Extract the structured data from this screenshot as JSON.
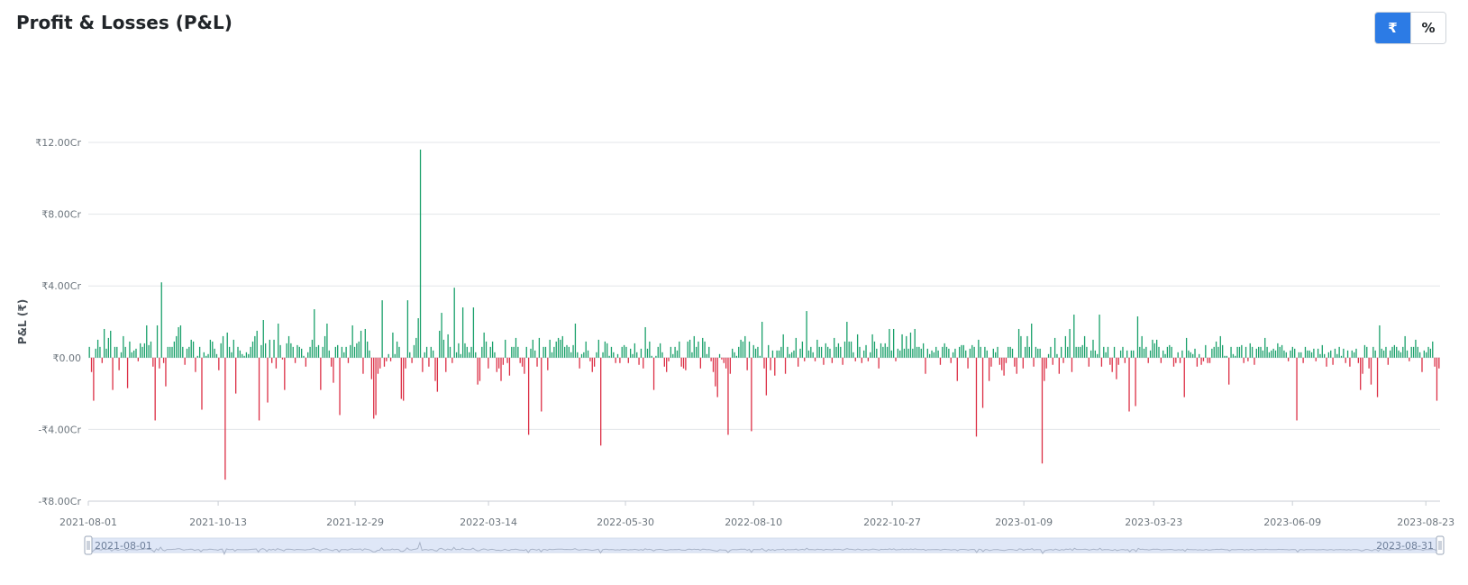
{
  "header": {
    "title": "Profit & Losses (P&L)",
    "toggle": {
      "rupee_label": "₹",
      "percent_label": "%",
      "selected": "rupee"
    }
  },
  "colors": {
    "profit": "#19a06a",
    "loss": "#dc2f45",
    "grid": "#e3e6ea",
    "toggle_active": "#2c7be5",
    "zoom_fill": "#dfe7f7"
  },
  "chart_data": {
    "type": "bar",
    "title": "",
    "xlabel": "",
    "ylabel": "P&L (₹)",
    "y_unit": "Cr",
    "ylim": [
      -8,
      12
    ],
    "y_ticks": [
      {
        "value": 12,
        "label": "₹12.00Cr"
      },
      {
        "value": 8,
        "label": "₹8.00Cr"
      },
      {
        "value": 4,
        "label": "₹4.00Cr"
      },
      {
        "value": 0,
        "label": "₹0.00"
      },
      {
        "value": -4,
        "label": "-₹4.00Cr"
      },
      {
        "value": -8,
        "label": "-₹8.00Cr"
      }
    ],
    "x_range": [
      "2021-08-01",
      "2023-08-31"
    ],
    "x_ticks": [
      "2021-08-01",
      "2021-10-13",
      "2021-12-29",
      "2022-03-14",
      "2022-05-30",
      "2022-08-10",
      "2022-10-27",
      "2023-01-09",
      "2023-03-23",
      "2023-06-09",
      "2023-08-23"
    ],
    "grid": true,
    "legend": "none",
    "data_zoom": {
      "start_label": "2021-08-01",
      "end_label": "2023-08-31"
    },
    "series": [
      {
        "values": [
          0.6,
          -0.8,
          -2.4,
          0.5,
          1.0,
          0.6,
          -0.3,
          1.6,
          0.5,
          1.1,
          1.5,
          -1.8,
          0.6,
          0.6,
          -0.7,
          0.3,
          1.2,
          0.6,
          -1.7,
          0.9,
          0.3,
          0.4,
          0.5,
          -0.2,
          0.8,
          0.6,
          0.8,
          1.8,
          0.7,
          0.9,
          -0.5,
          -3.5,
          1.8,
          -0.6,
          4.2,
          -0.3,
          -1.6,
          0.6,
          0.6,
          0.6,
          0.9,
          1.2,
          1.7,
          1.8,
          0.6,
          -0.4,
          0.5,
          0.6,
          1.0,
          0.9,
          -0.8,
          0.1,
          0.6,
          -2.9,
          0.3,
          0.1,
          0.2,
          1.0,
          0.9,
          0.5,
          0.2,
          -0.7,
          0.8,
          1.2,
          -6.8,
          1.4,
          0.6,
          0.3,
          1.0,
          -2.0,
          0.6,
          0.4,
          0.2,
          0.1,
          0.3,
          0.2,
          0.6,
          0.9,
          1.2,
          1.5,
          -3.5,
          0.7,
          2.1,
          0.8,
          -2.5,
          1.0,
          -0.3,
          1.0,
          -0.6,
          1.9,
          0.7,
          -0.1,
          -1.8,
          0.8,
          1.2,
          0.8,
          0.6,
          -0.3,
          0.7,
          0.6,
          0.5,
          0.1,
          -0.5,
          0.3,
          0.6,
          1.0,
          2.7,
          0.6,
          0.7,
          -1.8,
          0.6,
          1.2,
          1.9,
          0.4,
          -0.5,
          -1.4,
          0.6,
          0.7,
          -3.2,
          0.6,
          0.3,
          0.6,
          -0.3,
          0.7,
          1.8,
          0.6,
          0.8,
          0.9,
          1.5,
          -0.9,
          1.6,
          0.9,
          0.4,
          -1.2,
          -3.4,
          -3.2,
          -0.9,
          -0.6,
          3.2,
          -0.5,
          -0.2,
          0.2,
          -0.2,
          1.4,
          0.2,
          0.9,
          0.6,
          -2.3,
          -2.4,
          -0.6,
          3.2,
          0.3,
          -0.3,
          0.7,
          1.1,
          2.2,
          11.6,
          -0.8,
          0.3,
          0.6,
          -0.5,
          0.6,
          0.4,
          -1.3,
          -1.9,
          1.5,
          2.5,
          1.0,
          -0.8,
          1.3,
          0.6,
          -0.3,
          3.9,
          0.3,
          0.8,
          0.2,
          2.8,
          0.8,
          0.6,
          0.3,
          0.6,
          2.8,
          0.3,
          -1.5,
          -1.3,
          0.6,
          1.4,
          0.9,
          -0.6,
          0.6,
          0.9,
          0.3,
          -0.8,
          -0.6,
          -1.3,
          -0.4,
          1.0,
          -0.3,
          -1.0,
          0.6,
          0.6,
          1.1,
          0.6,
          -0.3,
          -0.5,
          -0.9,
          0.6,
          -4.3,
          0.5,
          1.0,
          0.4,
          -0.5,
          1.1,
          -3.0,
          0.6,
          0.6,
          -0.7,
          1.0,
          0.3,
          0.6,
          0.9,
          1.1,
          1.0,
          1.2,
          0.6,
          0.7,
          0.6,
          0.3,
          0.7,
          1.9,
          0.3,
          -0.6,
          0.2,
          0.3,
          0.9,
          0.4,
          -0.2,
          -0.8,
          -0.5,
          0.3,
          1.0,
          -4.9,
          0.3,
          0.9,
          0.8,
          0.1,
          0.6,
          0.3,
          -0.3,
          0.2,
          -0.3,
          0.6,
          0.7,
          0.6,
          -0.3,
          0.5,
          0.2,
          0.8,
          0.3,
          -0.4,
          0.5,
          -0.6,
          1.7,
          0.5,
          0.9,
          0.1,
          -1.8,
          0.1,
          0.6,
          0.8,
          0.3,
          -0.5,
          -0.8,
          -0.2,
          0.6,
          0.2,
          0.6,
          0.4,
          0.9,
          -0.5,
          -0.6,
          -0.7,
          0.9,
          1.0,
          0.3,
          1.2,
          0.6,
          0.9,
          -0.6,
          1.1,
          0.9,
          0.2,
          0.6,
          -0.2,
          -0.8,
          -1.6,
          -2.2,
          0.2,
          -0.1,
          -0.3,
          -0.6,
          -4.3,
          -0.9,
          0.5,
          0.3,
          0.1,
          0.6,
          1.0,
          0.9,
          1.2,
          -0.7,
          0.9,
          -4.1,
          0.7,
          0.5,
          0.6,
          0.1,
          2.0,
          -0.6,
          -2.1,
          0.7,
          -0.7,
          0.4,
          -1.0,
          0.4,
          0.4,
          0.6,
          1.3,
          -0.9,
          0.6,
          0.2,
          0.3,
          0.4,
          1.1,
          -0.5,
          0.5,
          0.9,
          -0.2,
          2.6,
          0.4,
          0.6,
          0.3,
          -0.2,
          1.0,
          0.6,
          0.6,
          -0.4,
          0.8,
          0.6,
          0.5,
          -0.3,
          1.1,
          0.6,
          0.8,
          0.6,
          -0.4,
          0.9,
          2.0,
          0.9,
          0.9,
          0.3,
          -0.2,
          1.3,
          0.6,
          -0.3,
          0.4,
          0.7,
          -0.2,
          0.3,
          1.3,
          0.9,
          0.5,
          -0.6,
          0.8,
          0.6,
          0.8,
          0.6,
          1.6,
          0.4,
          1.6,
          -0.2,
          0.5,
          0.4,
          1.3,
          0.5,
          1.2,
          0.5,
          1.4,
          0.5,
          1.6,
          0.6,
          0.6,
          0.5,
          0.8,
          -0.9,
          0.5,
          0.2,
          0.4,
          0.3,
          0.6,
          0.4,
          -0.4,
          0.6,
          0.8,
          0.6,
          0.5,
          -0.3,
          0.3,
          0.5,
          -1.3,
          0.6,
          0.7,
          0.7,
          0.4,
          -0.6,
          0.5,
          0.7,
          0.6,
          -4.4,
          1.0,
          0.6,
          -2.8,
          0.6,
          0.4,
          -1.3,
          -0.5,
          0.5,
          0.3,
          0.6,
          -0.4,
          -0.7,
          -1.0,
          -0.3,
          0.6,
          0.6,
          0.5,
          -0.5,
          -0.9,
          1.6,
          1.2,
          -0.6,
          0.6,
          1.2,
          0.6,
          1.9,
          -0.5,
          0.6,
          0.5,
          0.5,
          -5.9,
          -1.3,
          -0.6,
          0.2,
          0.6,
          -0.4,
          1.1,
          0.2,
          -0.9,
          0.6,
          -0.3,
          1.2,
          0.6,
          1.6,
          -0.8,
          2.4,
          0.6,
          0.6,
          0.6,
          0.7,
          1.2,
          0.6,
          -0.5,
          0.4,
          1.0,
          0.4,
          0.2,
          2.4,
          -0.5,
          0.6,
          0.3,
          0.6,
          -0.4,
          -0.8,
          0.6,
          -1.2,
          -0.4,
          0.4,
          0.6,
          -0.3,
          0.4,
          -3.0,
          0.4,
          0.4,
          -2.7,
          2.3,
          0.6,
          1.2,
          0.5,
          0.6,
          -0.3,
          0.4,
          1.0,
          0.8,
          1.0,
          0.6,
          -0.3,
          0.4,
          0.2,
          0.6,
          0.7,
          0.6,
          -0.5,
          -0.3,
          0.3,
          -0.3,
          0.4,
          -2.2,
          1.1,
          0.4,
          0.3,
          0.2,
          0.5,
          -0.5,
          0.2,
          -0.4,
          -0.2,
          0.7,
          -0.3,
          -0.3,
          0.5,
          0.6,
          0.9,
          0.6,
          1.2,
          0.7,
          0.1,
          0.1,
          -1.5,
          0.6,
          0.2,
          0.1,
          0.6,
          0.6,
          0.7,
          -0.3,
          0.6,
          -0.2,
          0.8,
          0.6,
          -0.4,
          0.5,
          0.6,
          0.6,
          0.4,
          1.1,
          0.6,
          0.3,
          0.4,
          0.5,
          0.4,
          0.8,
          0.6,
          0.7,
          0.4,
          0.3,
          -0.2,
          0.4,
          0.6,
          0.5,
          -3.5,
          0.3,
          0.3,
          -0.3,
          0.6,
          0.4,
          0.4,
          0.3,
          0.5,
          -0.2,
          0.5,
          0.2,
          0.7,
          0.2,
          -0.5,
          0.3,
          0.4,
          -0.4,
          0.5,
          0.2,
          0.6,
          0.1,
          0.5,
          -0.3,
          0.4,
          -0.5,
          0.4,
          0.3,
          0.5,
          -0.3,
          -1.8,
          -0.9,
          0.7,
          0.6,
          -0.6,
          -1.5,
          0.6,
          0.4,
          -2.2,
          1.8,
          0.5,
          0.4,
          0.6,
          -0.4,
          0.4,
          0.6,
          0.7,
          0.6,
          0.4,
          0.3,
          0.6,
          1.2,
          0.4,
          -0.2,
          0.6,
          0.6,
          1.0,
          0.6,
          0.3,
          -0.8,
          0.4,
          0.3,
          0.6,
          0.5,
          0.9,
          -0.5,
          -2.4,
          -0.6
        ]
      }
    ]
  }
}
